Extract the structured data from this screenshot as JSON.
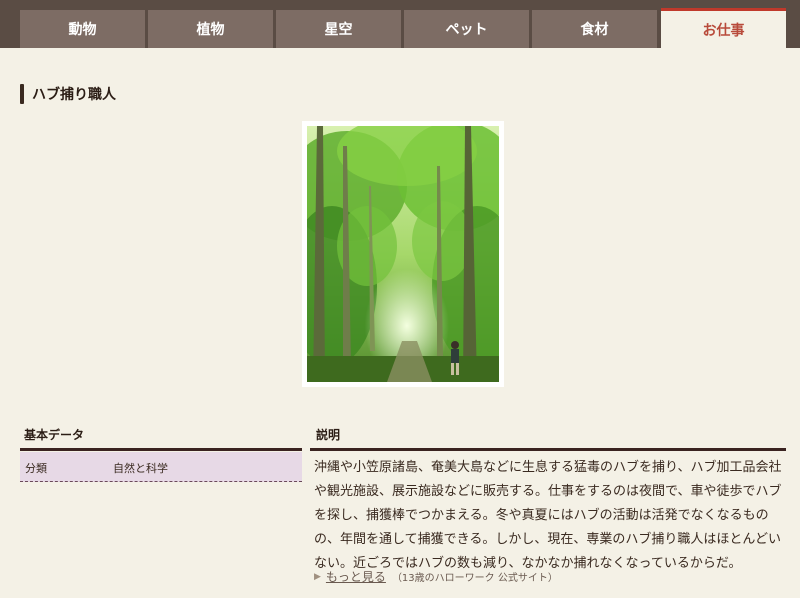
{
  "tabs": [
    {
      "label": "動物",
      "active": false
    },
    {
      "label": "植物",
      "active": false
    },
    {
      "label": "星空",
      "active": false
    },
    {
      "label": "ペット",
      "active": false
    },
    {
      "label": "食材",
      "active": false
    },
    {
      "label": "お仕事",
      "active": true
    }
  ],
  "page_title": "ハブ捕り職人",
  "basic_data": {
    "heading": "基本データ",
    "rows": [
      {
        "label": "分類",
        "value": "自然と科学"
      }
    ]
  },
  "description": {
    "heading": "説明",
    "text": "沖縄や小笠原諸島、奄美大島などに生息する猛毒のハブを捕り、ハブ加工品会社や観光施設、展示施設などに販売する。仕事をするのは夜間で、車や徒歩でハブを探し、捕獲棒でつかまえる。冬や真夏にはハブの活動は活発でなくなるものの、年間を通して捕獲できる。しかし、現在、専業のハブ捕り職人はほとんどいない。近ごろではハブの数も減り、なかなか捕れなくなっているからだ。"
  },
  "more_link": {
    "label": "もっと見る",
    "source": "（13歳のハローワーク 公式サイト）"
  },
  "colors": {
    "topbar": "#5a4c44",
    "tab": "#7d6c64",
    "active_tab_text": "#b84a3a",
    "background": "#f4f1e6",
    "data_row": "#e7d9e6"
  }
}
